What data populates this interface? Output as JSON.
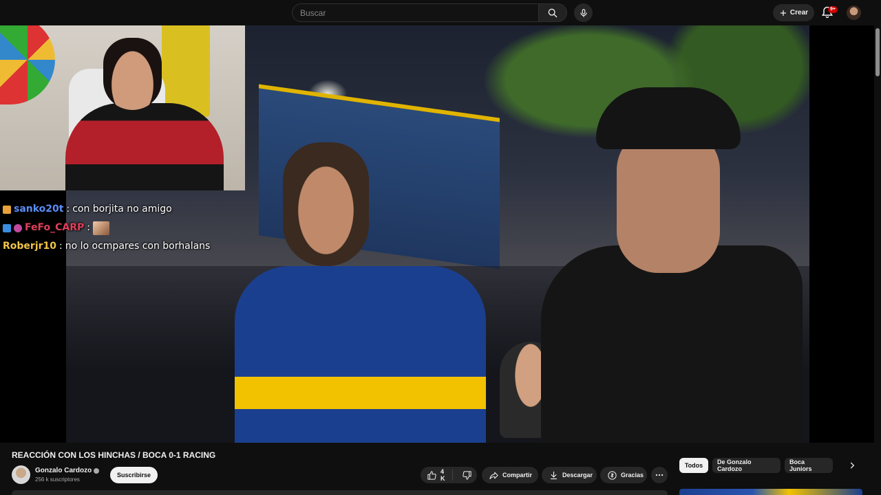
{
  "header": {
    "search_placeholder": "Buscar",
    "create_label": "Crear",
    "notifications_badge": "9+"
  },
  "chat": {
    "messages": [
      {
        "user": "sanko20t",
        "user_color": "#5b8df5",
        "separator": ":",
        "message": "con borjita no amigo"
      },
      {
        "user": "FeFo_CARP",
        "user_color": "#e0405a",
        "separator": ":",
        "message": ""
      },
      {
        "user": "Roberjr10",
        "user_color": "#f2c34a",
        "separator": ":",
        "message": "no lo ocmpares con borhalans"
      }
    ]
  },
  "video": {
    "title": "REACCIÓN CON LOS HINCHAS / BOCA 0-1 RACING",
    "channel_name": "Gonzalo Cardozo",
    "subscribers": "256 k suscriptores",
    "subscribe_label": "Suscribirse"
  },
  "actions": {
    "like_count": "4 K",
    "share_label": "Compartir",
    "download_label": "Descargar",
    "thanks_label": "Gracias"
  },
  "chips": {
    "all": "Todos",
    "from_channel": "De Gonzalo Cardozo",
    "related": "Boca Juniors"
  },
  "colors": {
    "background": "#0f0f0f",
    "surface": "#272727",
    "text": "#f1f1f1",
    "secondary_text": "#aaaaaa",
    "badge_red": "#cc0000"
  },
  "icons": [
    "search-icon",
    "mic-icon",
    "plus-icon",
    "bell-icon",
    "like-icon",
    "dislike-icon",
    "share-icon",
    "download-icon",
    "thanks-icon",
    "more-icon",
    "chevron-right-icon",
    "verified-icon"
  ]
}
